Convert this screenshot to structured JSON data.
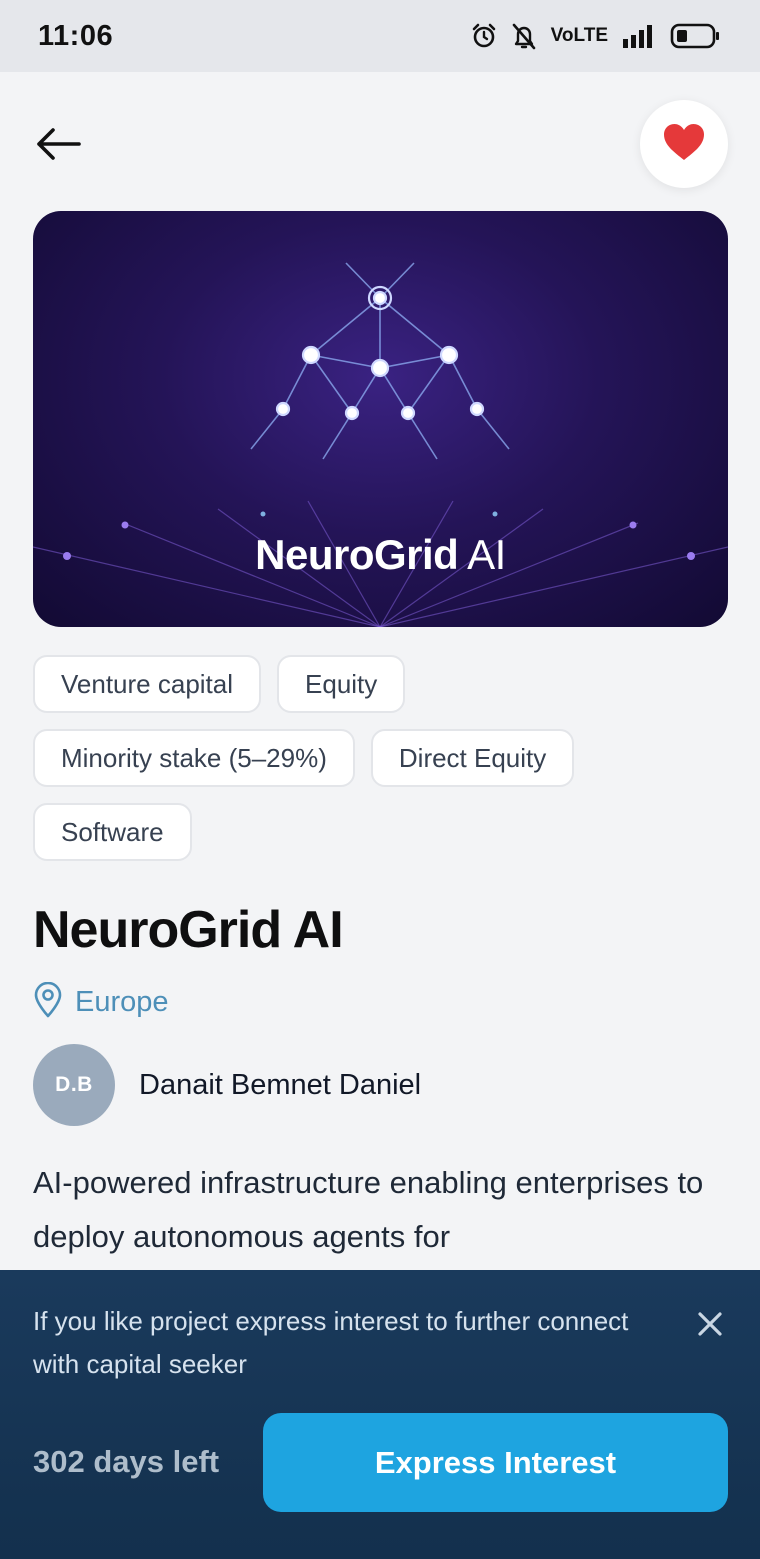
{
  "status_bar": {
    "time": "11:06",
    "network_label": "VoLTE",
    "icons": [
      "alarm-icon",
      "mute-icon",
      "signal-icon",
      "battery-icon"
    ]
  },
  "header": {
    "back_icon": "arrow-left-icon",
    "favorite_icon": "heart-icon",
    "favorite_active": true,
    "favorite_color": "#e5393a"
  },
  "hero": {
    "title_bold": "NeuroGrid",
    "title_light": "AI"
  },
  "tags": [
    "Venture capital",
    "Equity",
    "Minority stake (5–29%)",
    "Direct Equity",
    "Software"
  ],
  "project": {
    "title": "NeuroGrid AI",
    "location": "Europe",
    "location_icon": "map-pin-icon",
    "location_color": "#4d8fb8"
  },
  "owner": {
    "initials": "D.B",
    "name": "Danait Bemnet Daniel"
  },
  "description": "AI-powered infrastructure enabling enterprises to deploy autonomous agents for",
  "bottom_panel": {
    "message": "If you like project express interest to further connect with capital seeker",
    "close_icon": "close-icon",
    "days_left": "302 days left",
    "button_label": "Express Interest",
    "button_color": "#1ea4e0"
  }
}
